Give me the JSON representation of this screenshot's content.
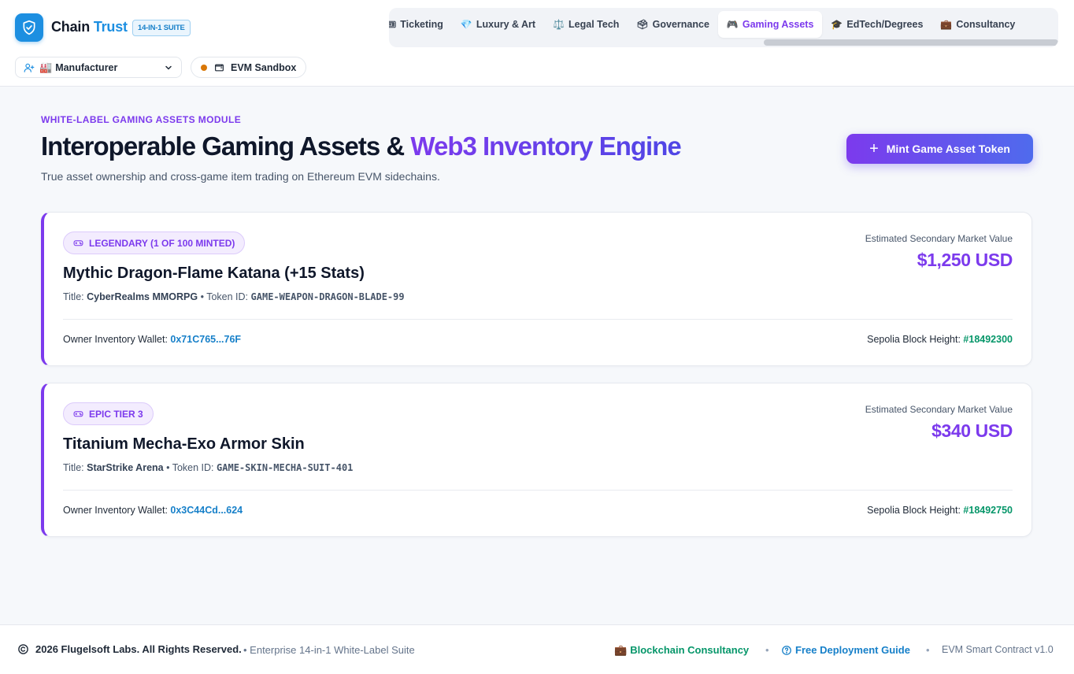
{
  "header": {
    "brand_main": "Chain",
    "brand_accent": "Trust",
    "suite_badge": "14-IN-1 SUITE",
    "role": {
      "emoji": "🏭",
      "value": "Manufacturer"
    },
    "network": "EVM Sandbox",
    "tabs": [
      {
        "icon": "🎟",
        "label": "Ticketing"
      },
      {
        "icon": "💎",
        "label": "Luxury & Art"
      },
      {
        "icon": "⚖️",
        "label": "Legal Tech"
      },
      {
        "icon": "🗳",
        "label": "Governance"
      },
      {
        "icon": "🎮",
        "label": "Gaming Assets",
        "active": true
      },
      {
        "icon": "🎓",
        "label": "EdTech/Degrees"
      },
      {
        "icon": "💼",
        "label": "Consultancy"
      }
    ]
  },
  "hero": {
    "eyebrow": "WHITE-LABEL GAMING ASSETS MODULE",
    "title_plain": "Interoperable Gaming Assets & ",
    "title_accent": "Web3 Inventory Engine",
    "subtitle": "True asset ownership and cross-game item trading on Ethereum EVM sidechains.",
    "mint_button": "Mint Game Asset Token"
  },
  "assets": [
    {
      "rarity": "LEGENDARY (1 OF 100 MINTED)",
      "name": "Mythic Dragon-Flame Katana (+15 Stats)",
      "title_label": "Title:",
      "title": "CyberRealms MMORPG",
      "token_label": "• Token ID:",
      "token_id": "GAME-WEAPON-DRAGON-BLADE-99",
      "wallet_label": "Owner Inventory Wallet:",
      "wallet": "0x71C765...76F",
      "value_label": "Estimated Secondary Market Value",
      "value": "$1,250 USD",
      "block_label": "Sepolia Block Height:",
      "block": "#18492300"
    },
    {
      "rarity": "EPIC TIER 3",
      "name": "Titanium Mecha-Exo Armor Skin",
      "title_label": "Title:",
      "title": "StarStrike Arena",
      "token_label": "• Token ID:",
      "token_id": "GAME-SKIN-MECHA-SUIT-401",
      "wallet_label": "Owner Inventory Wallet:",
      "wallet": "0x3C44Cd...624",
      "value_label": "Estimated Secondary Market Value",
      "value": "$340 USD",
      "block_label": "Sepolia Block Height:",
      "block": "#18492750"
    }
  ],
  "footer": {
    "copyright": "2026 Flugelsoft Labs. All Rights Reserved.",
    "suite": "• Enterprise 14-in-1 White-Label Suite",
    "consultancy_icon": "💼",
    "consultancy": "Blockchain Consultancy",
    "guide": "Free Deployment Guide",
    "separator": "•",
    "version": "EVM Smart Contract v1.0"
  },
  "colors": {
    "brand_blue": "#1d8fe1",
    "accent_purple": "#7c3aed",
    "wallet_blue": "#1780c9",
    "block_green": "#059669"
  }
}
